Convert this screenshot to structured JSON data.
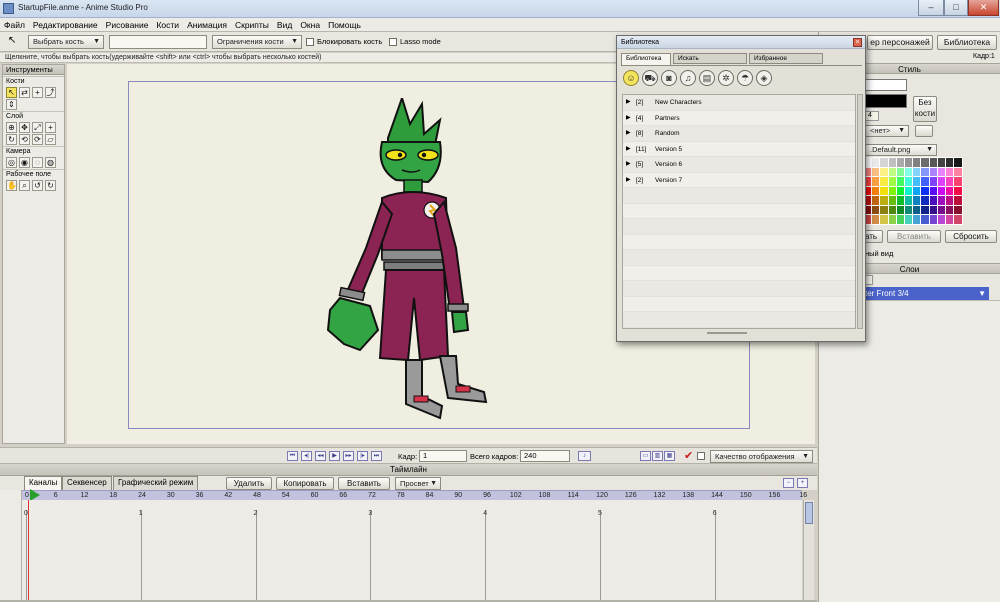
{
  "window": {
    "title": "StartupFile.anme - Anime Studio Pro"
  },
  "menu": [
    "Файл",
    "Редактирование",
    "Рисование",
    "Кости",
    "Анимация",
    "Скрипты",
    "Вид",
    "Окна",
    "Помощь"
  ],
  "toolbar": {
    "select_bone": "Выбрать кость",
    "bone_constraints": "Ограничения кости",
    "lock_bone": "Блокировать кость",
    "lasso_mode": "Lasso mode"
  },
  "hint": "Щелкните, чтобы выбрать кость(удерживайте <shift> или <ctrl> чтобы выбрать несколько костей)",
  "tools": {
    "title": "Инструменты",
    "sections": [
      "Кости",
      "Слой",
      "Камера",
      "Рабочее поле"
    ]
  },
  "playback": {
    "frame_label": "Кадр:",
    "frame_value": "1",
    "total_label": "Всего кадров:",
    "total_value": "240",
    "quality": "Качество отображения"
  },
  "timeline": {
    "title": "Таймлайн",
    "tabs": [
      "Каналы",
      "Секвенсер",
      "Графический режим"
    ],
    "delete": "Удалить",
    "copy": "Копировать",
    "paste": "Вставить",
    "onion": "Просвет",
    "ruler": [
      "0",
      "6",
      "12",
      "18",
      "24",
      "30",
      "36",
      "42",
      "48",
      "54",
      "60",
      "66",
      "72",
      "78",
      "84",
      "90",
      "96",
      "102",
      "108",
      "114",
      "120",
      "126",
      "132",
      "138",
      "144",
      "150",
      "156",
      "16"
    ],
    "seconds": [
      "0",
      "1",
      "2",
      "3",
      "4",
      "5",
      "6"
    ]
  },
  "right": {
    "char_button": "ер персонажей",
    "library_button": "Библиотека",
    "frame_label": "Кадр:1",
    "style_title": "Стиль",
    "no_bone": "Без кости",
    "none_option": "<нет>",
    "field_value": "4",
    "brush_file": ".Default.png",
    "copy_btn": "ать",
    "paste_btn": "Вставить",
    "reset_btn": "Сбросить",
    "view_text": "ный вид",
    "layers_title": "Слои",
    "layer_name": "cter Front 3/4"
  },
  "library": {
    "title": "Библиотека",
    "tabs": [
      "Библиотека",
      "Искать",
      "Избранное"
    ],
    "icons": [
      "character-icon",
      "vehicle-icon",
      "camera-icon",
      "audio-icon",
      "film-icon",
      "particles-icon",
      "prop-icon",
      "cube-icon"
    ],
    "items": [
      {
        "count": "[2]",
        "name": "New Characters"
      },
      {
        "count": "[4]",
        "name": "Partners"
      },
      {
        "count": "[8]",
        "name": "Random"
      },
      {
        "count": "[11]",
        "name": "Version 5"
      },
      {
        "count": "[5]",
        "name": "Version 6"
      },
      {
        "count": "[2]",
        "name": "Version 7"
      }
    ]
  }
}
